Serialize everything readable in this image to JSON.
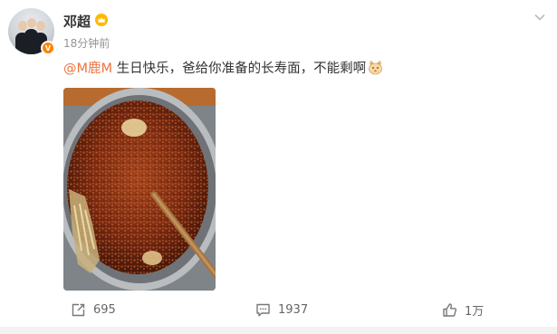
{
  "post": {
    "author": "邓超",
    "time": "18分钟前",
    "mention": "@M鹿M",
    "text": " 生日快乐，爸给你准备的长寿面，不能剩啊",
    "verified_badge": "V",
    "accent_color": "#eb7340",
    "verified_color": "#ff8200"
  },
  "icons": {
    "crown": "crown-icon",
    "more": "chevron-down-icon",
    "repost": "repost-icon",
    "comment": "comment-icon",
    "like": "like-icon",
    "emoji": "cat-emoji"
  },
  "actions": {
    "repost_count": "695",
    "comment_count": "1937",
    "like_count": "1万"
  }
}
